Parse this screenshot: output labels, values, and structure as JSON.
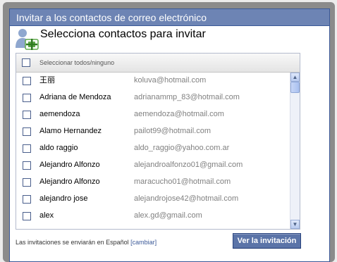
{
  "dialog": {
    "title": "Invitar a los contactos de correo electrónico"
  },
  "header": {
    "icon": "add-contacts-icon",
    "title": "Selecciona contactos para invitar"
  },
  "contacts": {
    "select_all_label": "Seleccionar todos/ninguno",
    "rows": [
      {
        "name": "王丽",
        "email": "koluva@hotmail.com"
      },
      {
        "name": "Adriana de Mendoza",
        "email": "adrianammp_83@hotmail.com"
      },
      {
        "name": "aemendoza",
        "email": "aemendoza@hotmail.com"
      },
      {
        "name": "Alamo Hernandez",
        "email": "pailot99@hotmail.com"
      },
      {
        "name": "aldo raggio",
        "email": "aldo_raggio@yahoo.com.ar"
      },
      {
        "name": "Alejandro Alfonzo",
        "email": "alejandroalfonzo01@gmail.com"
      },
      {
        "name": "Alejandro Alfonzo",
        "email": "maracucho01@hotmail.com"
      },
      {
        "name": "alejandro jose",
        "email": "alejandrojose42@hotmail.com"
      },
      {
        "name": "alex",
        "email": "alex.gd@gmail.com"
      }
    ]
  },
  "footer": {
    "language_note": "Las invitaciones se enviarán en Español",
    "change_link": "[cambiar]",
    "send_button": "Ver la invitación"
  },
  "colors": {
    "title_bar": "#6d84b4",
    "border": "#3b5998",
    "button": "#5b74a8",
    "icon_green": "#5fa84a"
  }
}
